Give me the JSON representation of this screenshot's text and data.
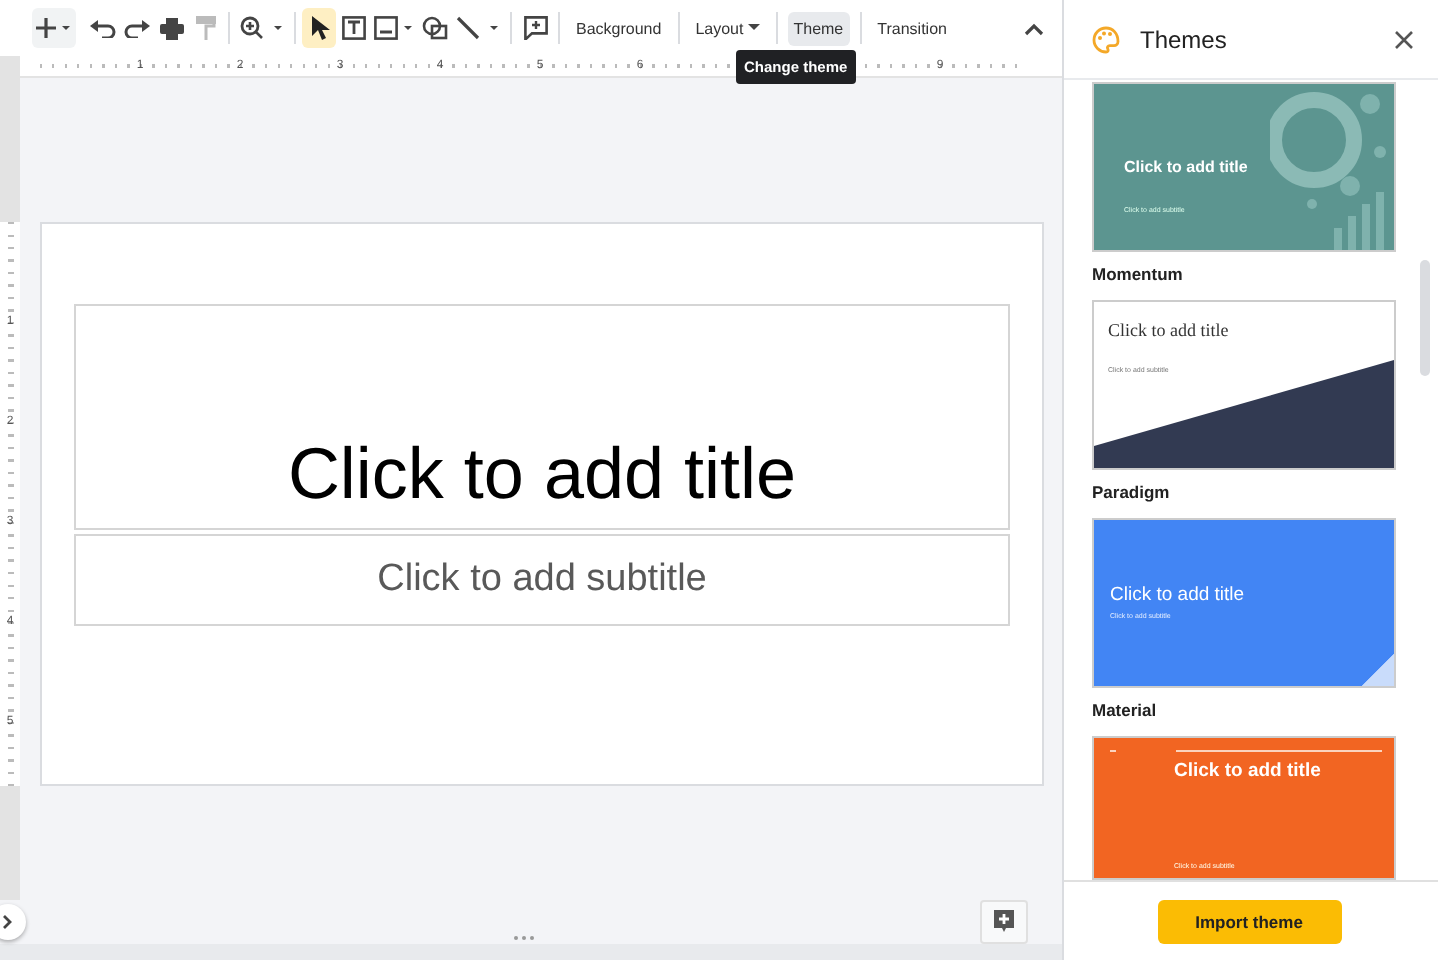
{
  "toolbar": {
    "tools": [
      {
        "kind": "pointer",
        "selected": true
      },
      {
        "kind": "textbox",
        "selected": false
      },
      {
        "kind": "image",
        "selected": false
      },
      {
        "kind": "shape",
        "selected": false
      },
      {
        "kind": "line",
        "selected": false
      }
    ],
    "buttons": [
      {
        "label": "Background",
        "dropdown": false,
        "selected": false
      },
      {
        "label": "Layout",
        "dropdown": true,
        "selected": false
      },
      {
        "label": "Theme",
        "dropdown": false,
        "selected": true
      },
      {
        "label": "Transition",
        "dropdown": false,
        "selected": false
      }
    ],
    "tooltip": "Change theme"
  },
  "ruler": {
    "horizontal": [
      "1",
      "2",
      "3",
      "4",
      "5",
      "6",
      "9"
    ],
    "vertical": [
      "1",
      "2",
      "3",
      "4",
      "5"
    ]
  },
  "slide": {
    "title_placeholder": "Click to add title",
    "subtitle_placeholder": "Click to add subtitle"
  },
  "themes_panel": {
    "title": "Themes",
    "themes": [
      {
        "kind": "momentum",
        "name": "Momentum",
        "title": "Click to add title",
        "subtitle": "Click to add subtitle"
      },
      {
        "kind": "paradigm",
        "name": "Paradigm",
        "title": "Click to add title",
        "subtitle": "Click to add subtitle"
      },
      {
        "kind": "material",
        "name": "Material",
        "title": "Click to add title",
        "subtitle": "Click to add subtitle"
      },
      {
        "kind": "coral",
        "title": "Click to add title",
        "subtitle": "Click to add subtitle"
      }
    ],
    "import_button": "Import theme"
  }
}
